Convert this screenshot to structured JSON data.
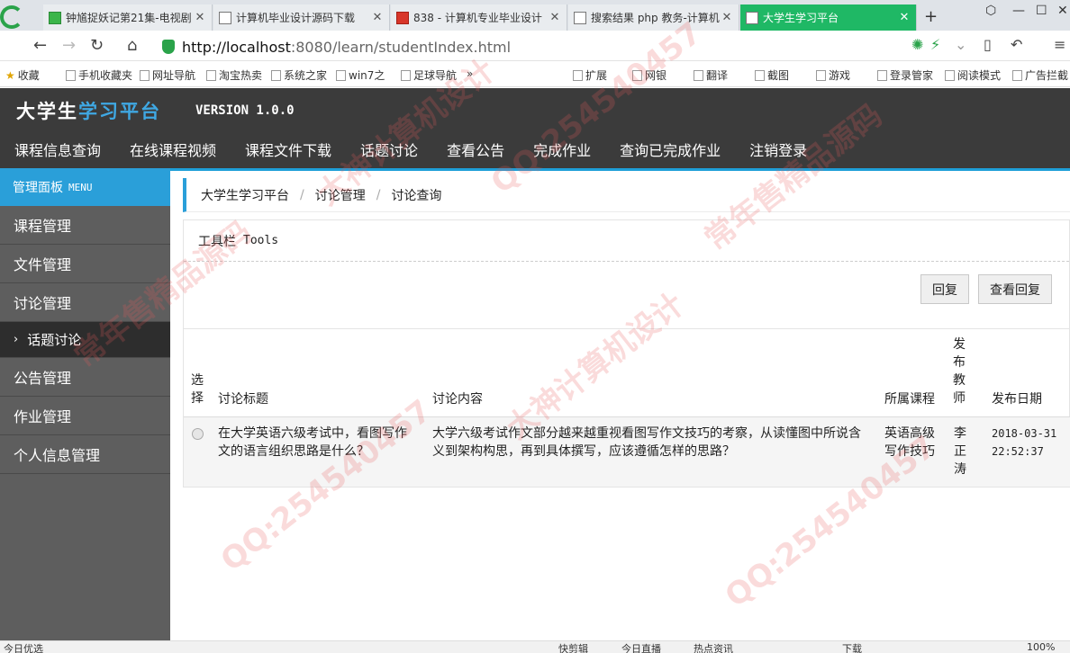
{
  "browser": {
    "tabs": [
      {
        "title": "钟馗捉妖记第21集-电视剧",
        "icon": "video-icon"
      },
      {
        "title": "计算机毕业设计源码下载",
        "icon": "page-icon"
      },
      {
        "title": "838 - 计算机专业毕业设计",
        "icon": "flag-icon"
      },
      {
        "title": "搜索结果 php 教务-计算机",
        "icon": "page-icon"
      },
      {
        "title": "大学生学习平台",
        "icon": "site-icon",
        "active": true
      }
    ],
    "url_host": "http://localhost",
    "url_rest": ":8080/learn/studentIndex.html",
    "bookmarks": [
      "收藏",
      "手机收藏夹",
      "网址导航",
      "淘宝热卖",
      "系统之家",
      "win7之",
      "足球导航"
    ],
    "bookmarks_more": "»",
    "extensions": [
      "扩展",
      "网银",
      "翻译",
      "截图",
      "游戏",
      "登录管家",
      "阅读模式",
      "广告拦截"
    ]
  },
  "site": {
    "brand_part1": "大学生",
    "brand_part2": "学习平台",
    "version": "VERSION 1.0.0",
    "nav": [
      "课程信息查询",
      "在线课程视频",
      "课程文件下载",
      "话题讨论",
      "查看公告",
      "完成作业",
      "查询已完成作业",
      "注销登录"
    ]
  },
  "sidebar": {
    "head": "管理面板",
    "head_en": "MENU",
    "items": [
      "课程管理",
      "文件管理",
      "讨论管理"
    ],
    "active_sub": "话题讨论",
    "items_after": [
      "公告管理",
      "作业管理",
      "个人信息管理"
    ]
  },
  "breadcrumb": [
    "大学生学习平台",
    "讨论管理",
    "讨论查询"
  ],
  "panel": {
    "title": "工具栏",
    "title_en": "Tools",
    "buttons": {
      "reply": "回复",
      "view_reply": "查看回复"
    }
  },
  "table": {
    "headers": {
      "select": "选择",
      "title": "讨论标题",
      "content": "讨论内容",
      "course": "所属课程",
      "teacher": "发布教师",
      "date": "发布日期"
    },
    "rows": [
      {
        "title": "在大学英语六级考试中，看图写作文的语言组织思路是什么？",
        "content": "大学六级考试作文部分越来越重视看图写作文技巧的考察，从读懂图中所说含义到架构构思，再到具体撰写，应该遵循怎样的思路？",
        "course": "英语高级写作技巧",
        "teacher": "李正涛",
        "date": "2018-03-31 22:52:37"
      }
    ]
  },
  "watermarks": [
    "大神计算机设计",
    "常年售精品源码",
    "QQ:254540457"
  ],
  "statusbar": {
    "left": "今日优选",
    "items": [
      "快剪辑",
      "今日直播",
      "热点资讯",
      "下载"
    ],
    "zoom": "100%"
  }
}
